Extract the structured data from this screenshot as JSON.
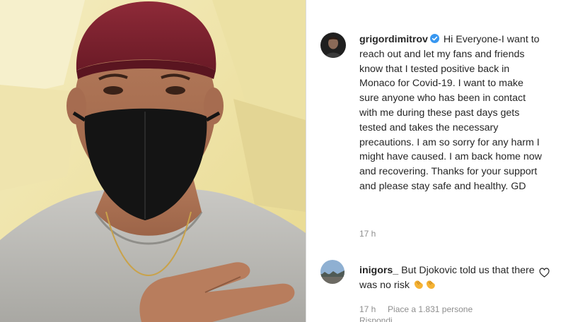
{
  "post": {
    "username": "grigordimitrov",
    "caption": "Hi Everyone-I want to reach out and let my fans and friends know that I tested positive back in Monaco for Covid-19. I want to make sure anyone who has been in contact with me during these past days gets tested and takes the necessary precautions. I am so sorry for any harm I might have caused. I am back home now and recovering. Thanks for your support and please stay safe and healthy. GD",
    "time": "17 h"
  },
  "comment": {
    "username": "inigors_",
    "text": "But Djokovic told us that there was no risk",
    "emoji": [
      "clapping-hands",
      "clapping-hands"
    ],
    "time": "17 h",
    "likes": "Piace a 1.831 persone",
    "reply": "Rispondi"
  },
  "colors": {
    "verified": "#3897f0",
    "text": "#262626",
    "secondary": "#8e8e8e",
    "divider": "#dbdbdb"
  }
}
